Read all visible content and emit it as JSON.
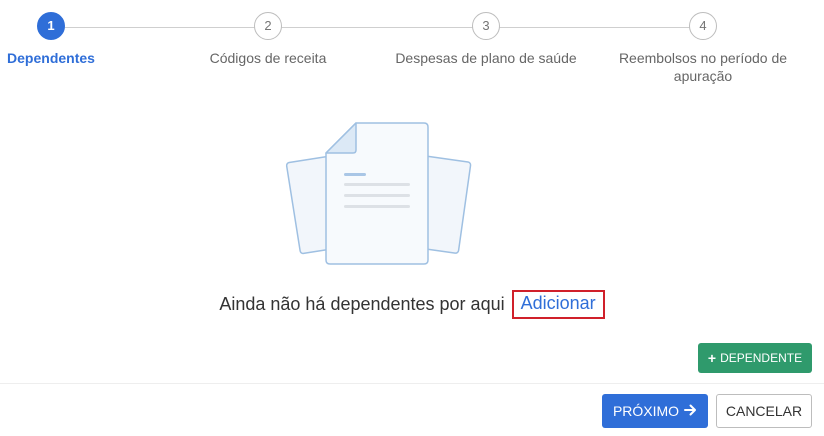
{
  "stepper": {
    "steps": [
      {
        "number": "1",
        "label": "Dependentes",
        "active": true
      },
      {
        "number": "2",
        "label": "Códigos de receita",
        "active": false
      },
      {
        "number": "3",
        "label": "Despesas de plano de saúde",
        "active": false
      },
      {
        "number": "4",
        "label": "Reembolsos no período de apuração",
        "active": false
      }
    ]
  },
  "illustration": {
    "icon": "empty-documents-icon"
  },
  "empty_state": {
    "message": "Ainda não há dependentes por aqui",
    "add_link": "Adicionar"
  },
  "actions": {
    "add_dependent_icon": "plus-icon",
    "add_dependent_label": "DEPENDENTE",
    "next_label": "PRÓXIMO",
    "next_icon": "arrow-right-icon",
    "cancel_label": "CANCELAR"
  },
  "colors": {
    "primary": "#2f6ed8",
    "success": "#2f9a6c",
    "highlight_border": "#d0202a"
  }
}
